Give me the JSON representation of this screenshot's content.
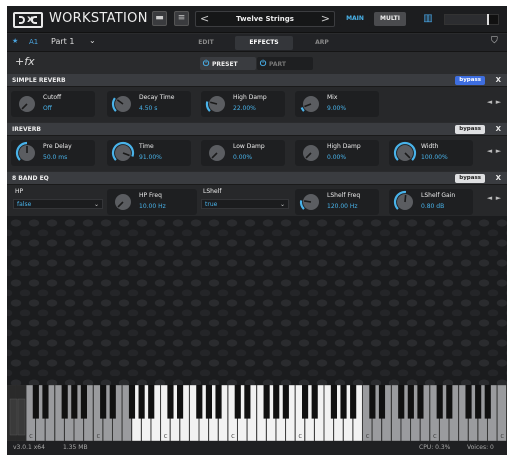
{
  "app": {
    "title": "WORKSTATION"
  },
  "toolbar": {
    "folder_icon": "folder-icon",
    "menu_icon": "menu-icon",
    "preset_name": "Twelve Strings",
    "prev": "<",
    "next": ">",
    "main_label": "MAIN",
    "multi_label": "MULTI",
    "keyboard_icon": "keyboard-icon",
    "master_volume": 0.8
  },
  "part": {
    "id": "A1",
    "name": "Part 1",
    "tabs": [
      {
        "label": "EDIT",
        "active": false
      },
      {
        "label": "EFFECTS",
        "active": true
      },
      {
        "label": "ARP",
        "active": false
      }
    ]
  },
  "fx": {
    "add_label": "+fx",
    "preset_toggle": "PRESET",
    "part_toggle": "PART"
  },
  "effects": [
    {
      "name": "SIMPLE REVERB",
      "bypass_label": "bypass",
      "bypass_active": true,
      "close": "X",
      "params": [
        {
          "label": "Cutoff",
          "value": "Off",
          "level": 0.0
        },
        {
          "label": "Decay Time",
          "value": "4.50 s",
          "level": 0.3
        },
        {
          "label": "High Damp",
          "value": "22.00%",
          "level": 0.22
        },
        {
          "label": "Mix",
          "value": "9.00%",
          "level": 0.09
        }
      ]
    },
    {
      "name": "IREVERB",
      "bypass_label": "bypass",
      "bypass_active": false,
      "close": "X",
      "params": [
        {
          "label": "Pre Delay",
          "value": "50.0 ms",
          "level": 0.5
        },
        {
          "label": "Time",
          "value": "91.00%",
          "level": 0.91
        },
        {
          "label": "Low Damp",
          "value": "0.00%",
          "level": 0.0
        },
        {
          "label": "High Damp",
          "value": "0.00%",
          "level": 0.0
        },
        {
          "label": "Width",
          "value": "100.00%",
          "level": 1.0
        }
      ]
    },
    {
      "name": "8 BAND EQ",
      "bypass_label": "bypass",
      "bypass_active": false,
      "close": "X",
      "hp": {
        "label": "HP",
        "value": "false"
      },
      "hp_freq": {
        "label": "HP Freq",
        "value": "10.00 Hz",
        "level": 0.0
      },
      "lshelf": {
        "label": "LShelf",
        "value": "true"
      },
      "lshelf_freq": {
        "label": "LShelf Freq",
        "value": "120.00 Hz",
        "level": 0.2
      },
      "lshelf_gain": {
        "label": "LShelf Gain",
        "value": "0.80 dB",
        "level": 0.52
      }
    }
  ],
  "nav": {
    "left": "◄",
    "right": "►"
  },
  "keyboard": {
    "octave_labels": [
      "C",
      "C",
      "C",
      "C",
      "C",
      "C",
      "C",
      "C"
    ]
  },
  "status": {
    "version": "v3.0.1 x64",
    "memory": "1.35 MB",
    "cpu": "CPU: 0.3%",
    "voices": "Voices: 0"
  },
  "colors": {
    "accent": "#49b3ea",
    "bypass_active": "#3e6ee0"
  }
}
